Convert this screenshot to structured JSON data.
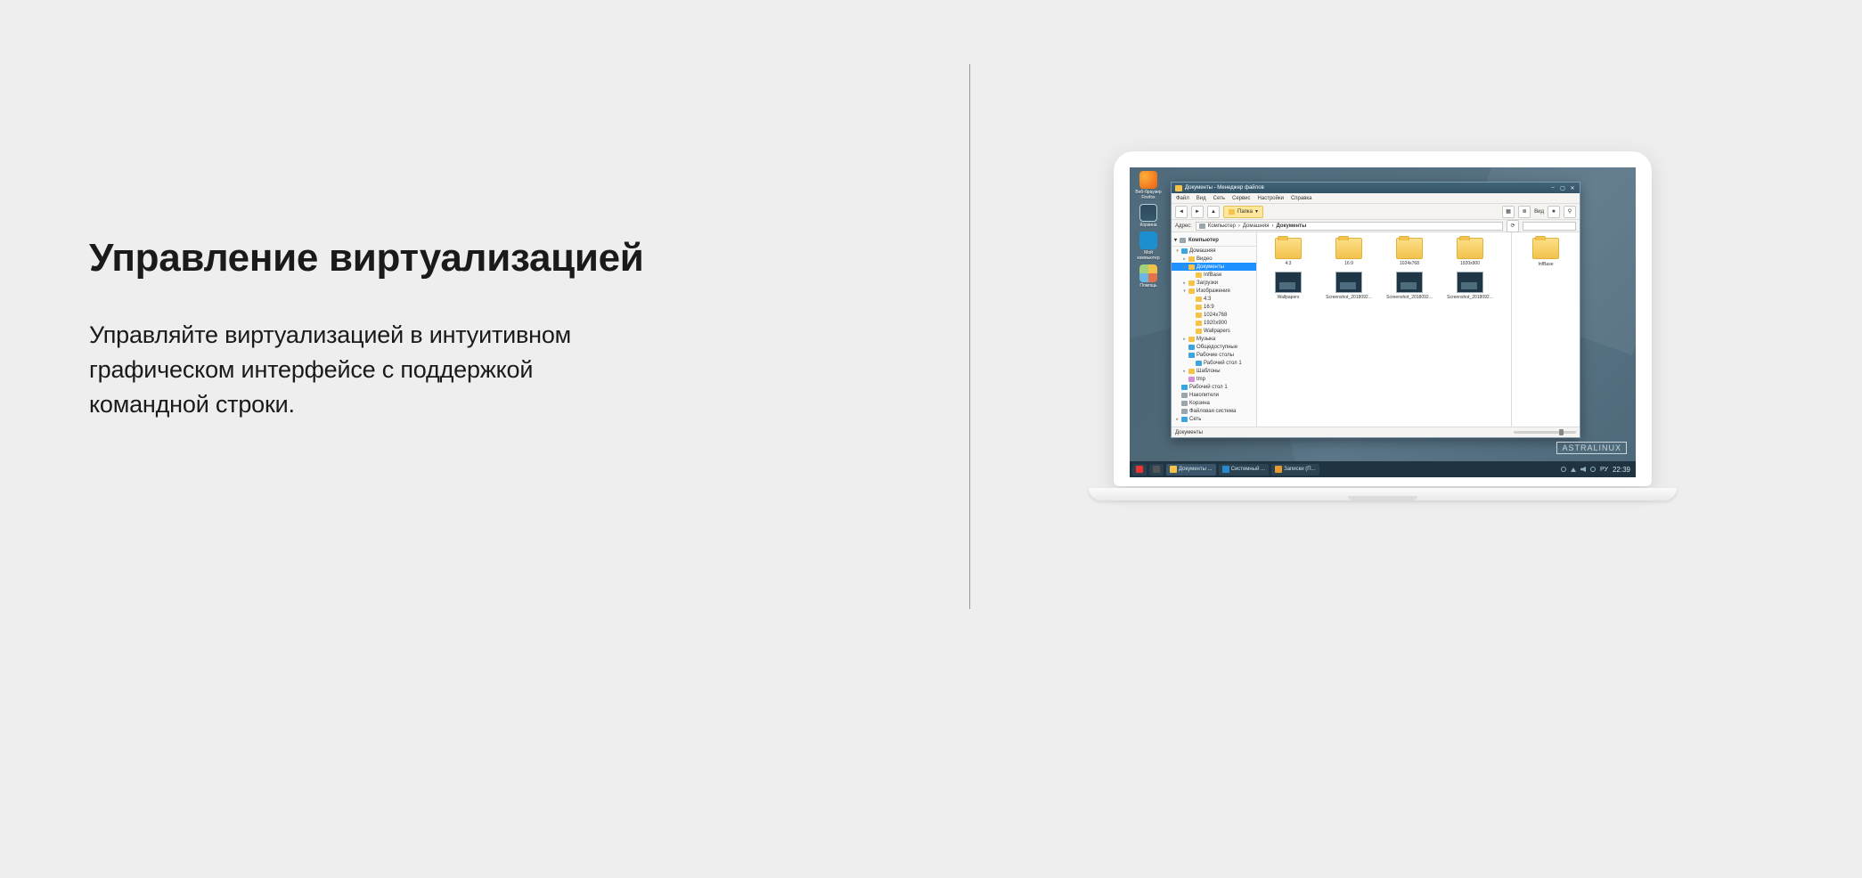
{
  "marketing": {
    "heading": "Управление виртуализацией",
    "body": "Управляйте виртуализацией  в интуитивном графическом интерфейсе с поддержкой командной строки."
  },
  "desktop": {
    "brand": "ASTRALINUX",
    "icons": [
      {
        "label": "Веб-браузер Firefox",
        "kind": "firefox"
      },
      {
        "label": "Корзина",
        "kind": "trash"
      },
      {
        "label": "Мой компьютер",
        "kind": "pc"
      },
      {
        "label": "Помощь",
        "kind": "help"
      }
    ]
  },
  "taskbar": {
    "items": [
      {
        "label": "",
        "kind": "start"
      },
      {
        "label": "Документы ...",
        "kind": "fm",
        "active": true
      },
      {
        "label": "Системный ...",
        "kind": "sys"
      },
      {
        "label": "Записки (П...",
        "kind": "notes"
      }
    ],
    "lang": "РУ",
    "clock": "22:39"
  },
  "fm": {
    "title": "Документы - Менеджер файлов",
    "menu": [
      "Файл",
      "Вид",
      "Сеть",
      "Сервис",
      "Настройки",
      "Справка"
    ],
    "toolbar": {
      "new_folder_label": "Папка"
    },
    "address": {
      "label": "Адрес:",
      "parts": [
        "Компьютер",
        "Домашняя",
        "Документы"
      ]
    },
    "tree_root": "Компьютер",
    "tree": [
      {
        "t": "▾",
        "ico": "blue",
        "label": "Домашняя",
        "pad": 0
      },
      {
        "t": "▸",
        "ico": "f",
        "label": "Видео",
        "pad": 1
      },
      {
        "t": "▾",
        "ico": "f",
        "label": "Документы",
        "pad": 1,
        "sel": true
      },
      {
        "t": "",
        "ico": "f",
        "label": "InfBase",
        "pad": 2
      },
      {
        "t": "▸",
        "ico": "f",
        "label": "Загрузки",
        "pad": 1
      },
      {
        "t": "▾",
        "ico": "f",
        "label": "Изображения",
        "pad": 1
      },
      {
        "t": "",
        "ico": "f",
        "label": "4:3",
        "pad": 2
      },
      {
        "t": "",
        "ico": "f",
        "label": "16:9",
        "pad": 2
      },
      {
        "t": "",
        "ico": "f",
        "label": "1024x768",
        "pad": 2
      },
      {
        "t": "",
        "ico": "f",
        "label": "1920x900",
        "pad": 2
      },
      {
        "t": "",
        "ico": "f",
        "label": "Wallpapers",
        "pad": 2
      },
      {
        "t": "▸",
        "ico": "f",
        "label": "Музыка",
        "pad": 1
      },
      {
        "t": "",
        "ico": "blue",
        "label": "Общедоступные",
        "pad": 1
      },
      {
        "t": "",
        "ico": "blue",
        "label": "Рабочие столы",
        "pad": 1
      },
      {
        "t": "",
        "ico": "blue",
        "label": "Рабочий стол 1",
        "pad": 2
      },
      {
        "t": "▸",
        "ico": "f",
        "label": "Шаблоны",
        "pad": 1
      },
      {
        "t": "",
        "ico": "tmp",
        "label": "tmp",
        "pad": 1
      },
      {
        "t": "",
        "ico": "blue",
        "label": "Рабочий стол 1",
        "pad": 0
      },
      {
        "t": "",
        "ico": "hd",
        "label": "Накопители",
        "pad": 0
      },
      {
        "t": "",
        "ico": "hd",
        "label": "Корзина",
        "pad": 0
      },
      {
        "t": "",
        "ico": "hd",
        "label": "Файловая система",
        "pad": 0
      },
      {
        "t": "▸",
        "ico": "blue",
        "label": "Сеть",
        "pad": 0
      }
    ],
    "grid": [
      {
        "kind": "folder",
        "label": "4:3"
      },
      {
        "kind": "folder",
        "label": "16:9"
      },
      {
        "kind": "folder",
        "label": "1024x768"
      },
      {
        "kind": "folder",
        "label": "1920x900"
      },
      {
        "kind": "img",
        "label": "Wallpapers"
      },
      {
        "kind": "img",
        "label": "Screenshot_2018092..."
      },
      {
        "kind": "img",
        "label": "Screenshot_2018092..."
      },
      {
        "kind": "img",
        "label": "Screenshot_2018092..."
      }
    ],
    "right": {
      "kind": "folder",
      "label": "InfBase"
    },
    "status": "Документы"
  }
}
